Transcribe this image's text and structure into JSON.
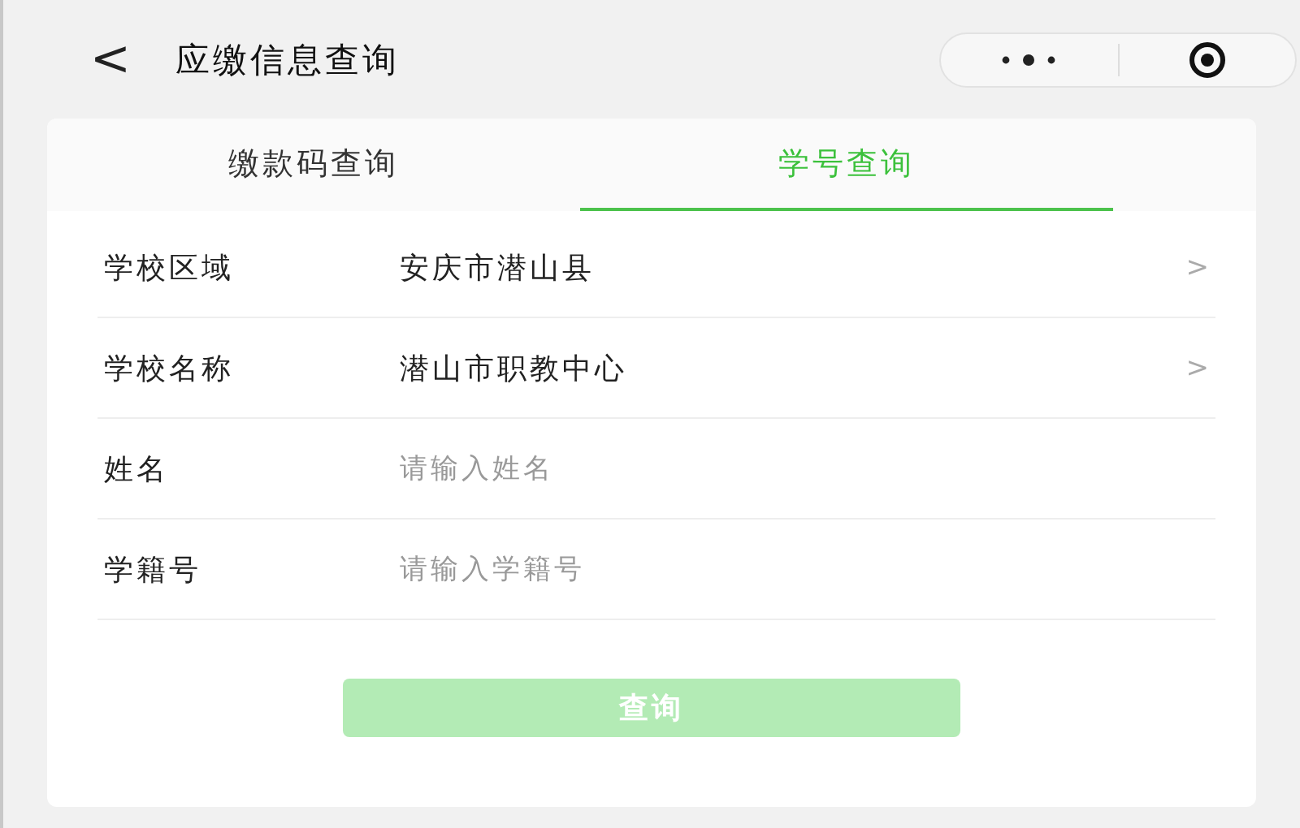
{
  "header": {
    "back": "<",
    "title": "应缴信息查询"
  },
  "tabs": [
    {
      "label": "缴款码查询",
      "selected": false
    },
    {
      "label": "学号查询",
      "selected": true
    }
  ],
  "fields": [
    {
      "kind": "select",
      "label": "学校区域",
      "value": "安庆市潜山县",
      "chevron": ">"
    },
    {
      "kind": "select",
      "label": "学校名称",
      "value": "潜山市职教中心",
      "chevron": ">"
    },
    {
      "kind": "input",
      "label": "姓名",
      "placeholder": "请输入姓名"
    },
    {
      "kind": "input",
      "label": "学籍号",
      "placeholder": "请输入学籍号"
    }
  ],
  "submit": {
    "label": "查询",
    "disabled": true
  }
}
